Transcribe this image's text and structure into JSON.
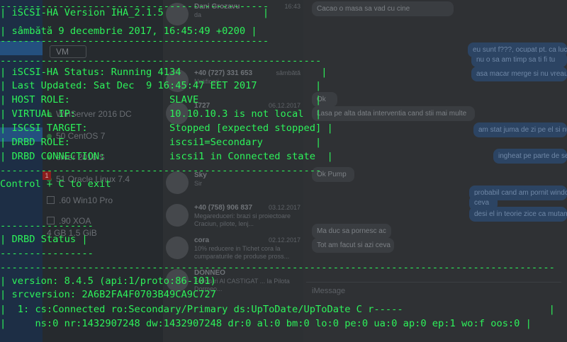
{
  "terminal": {
    "lines": [
      "----------------------------------------------",
      "| iSCSI-HA Version IHA_2.1.5                 |",
      "| sâmbătă 9 decembrie 2017, 16:45:49 +0200 |",
      "----------------------------------------------",
      "",
      "-------------------------------------------------------",
      "| iSCSI-HA Status: Running 4134                        |",
      "| Last Updated: Sat Dec  9 16:45:47 EET 2017          |",
      "| HOST ROLE:                 SLAVE                    |",
      "| VIRTUAL IP:                10.10.10.3 is not local  |",
      "| ISCSI TARGET:              Stopped [expected stopped] |",
      "| DRBD ROLE:                 iscsi1=Secondary         |",
      "| DRBD CONNECTION:           iscsi1 in Connected state  |",
      "-------------------------------------------------------",
      "Control + C to exit",
      "",
      "",
      "----------------",
      "| DRBD Status |",
      "----------------",
      "",
      "-----------------------------------------------------------------------------------------------",
      "| version: 8.4.5 (api:1/proto:86-101)",
      "| srcversion: 2A6B2FA4F0703B49CA9C727",
      "|  1: cs:Connected ro:Secondary/Primary ds:UpToDate/UpToDate C r-----                         |",
      "|     ns:0 nr:1432907248 dw:1432907248 dr:0 al:0 bm:0 lo:0 pe:0 ua:0 ap:0 ep:1 wo:f oos:0 |"
    ]
  },
  "background": {
    "vm_select_label": "VM",
    "vm_items": [
      {
        "label": "WinServer 2016 DC",
        "kind": "dot"
      },
      {
        "label": "50 CentOS 7",
        "kind": "dot"
      },
      {
        "label": "erver 2016 S",
        "kind": "dot"
      },
      {
        "label": "51 Oracle Linux 7.4",
        "kind": "dot"
      },
      {
        "label": ".60 Win10 Pro",
        "kind": "box"
      },
      {
        "label": ".90 XOA",
        "kind": "box"
      },
      {
        "label": "4 GB    1.5 GiB",
        "kind": "none"
      }
    ],
    "contacts": [
      {
        "name": "Dani Grozavu",
        "date": "16:43",
        "preview": "da"
      },
      {
        "name": "+40 (727) 331 653",
        "date": "sâmbătă",
        "preview": "Notificari"
      },
      {
        "name": "1727",
        "date": "06.12.2017",
        "preview": ""
      },
      {
        "name": "Sky",
        "date": "",
        "preview": "Sir"
      },
      {
        "name": "+40 (758) 906 837",
        "date": "03.12.2017",
        "preview": "Megareduceri: brazi si proiectoare Craciun, pilote, lenj..."
      },
      {
        "name": "cora",
        "date": "02.12.2017",
        "preview": "10% reducere in Tichet cora la cumparaturile de produse pross..."
      },
      {
        "name": "DONNEO",
        "date": "",
        "preview": "Felicitari Al CASTIGAT ... la Pilota Dormeo..."
      }
    ],
    "messages": [
      {
        "dir": "in",
        "text": "Cacao o masa sa vad cu cine"
      },
      {
        "dir": "out",
        "text": "eu sunt f???, ocupat pt. ca lucrez la ceva"
      },
      {
        "dir": "out",
        "text": "nu o sa am timp sa ti fi tu"
      },
      {
        "dir": "out",
        "text": "asa macar merge si nu vreau bani de la cineva"
      },
      {
        "dir": "in",
        "text": "Ok"
      },
      {
        "dir": "in",
        "text": "Lasa pe alta data interventia cand stii mai multe"
      },
      {
        "dir": "out",
        "text": "am stat juma de zi pe el si nu"
      },
      {
        "dir": "out",
        "text": "ingheat pe parte de server"
      },
      {
        "dir": "in",
        "text": "Ok Pump"
      },
      {
        "dir": "out",
        "text": "probabil cand am pornit windows"
      },
      {
        "dir": "out",
        "text": "ceva"
      },
      {
        "dir": "out",
        "text": "desi el in teorie zice ca mutam"
      },
      {
        "dir": "in",
        "text": "Ma duc sa pornesc ac"
      },
      {
        "dir": "in",
        "text": "Tot am facut si azi ceva"
      }
    ],
    "message_placeholder": "iMessage",
    "badges": [
      "1",
      "1"
    ]
  }
}
